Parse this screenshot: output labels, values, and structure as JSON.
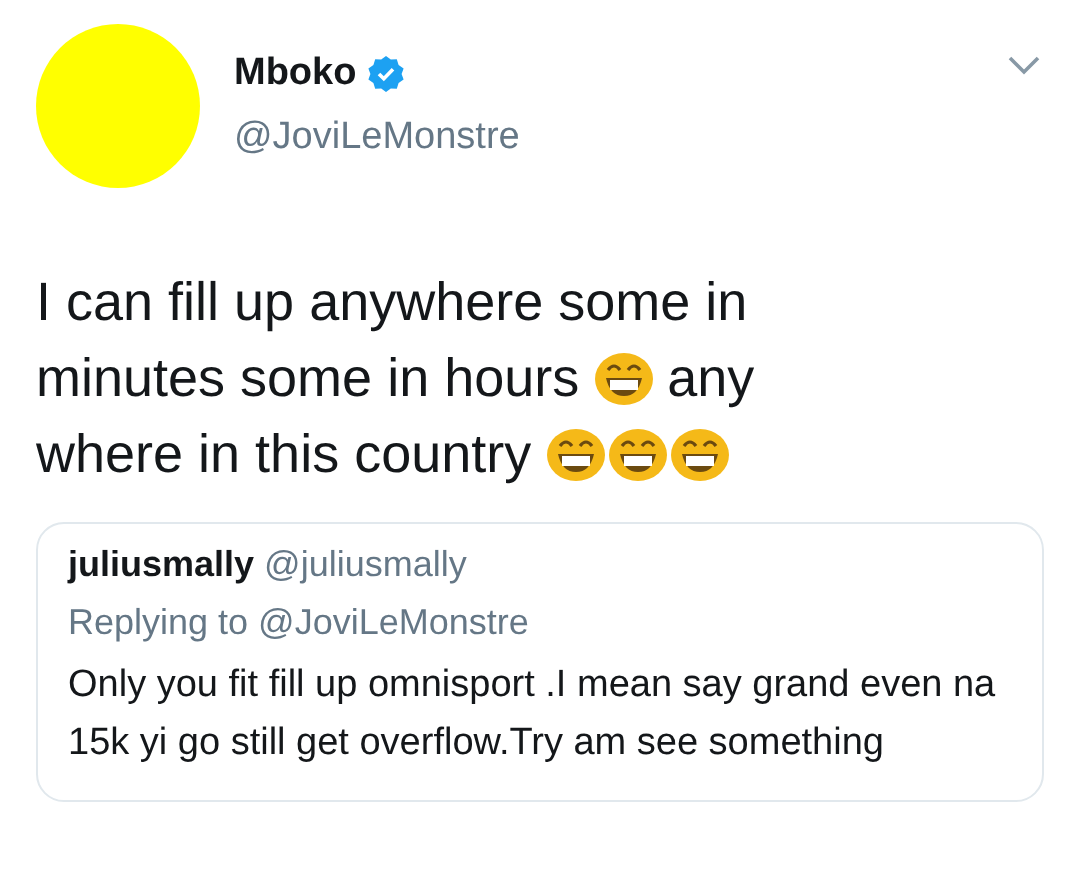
{
  "tweet": {
    "author": {
      "name": "Mboko",
      "verified": true,
      "handle": "@JoviLeMonstre"
    },
    "lines": [
      [
        {
          "kind": "text",
          "text": "I can fill up anywhere some in"
        }
      ],
      [
        {
          "kind": "text",
          "text": "minutes some in hours"
        },
        {
          "kind": "emoji"
        },
        {
          "kind": "text",
          "text": "any"
        }
      ],
      [
        {
          "kind": "text",
          "text": "where in this country"
        },
        {
          "kind": "emoji"
        },
        {
          "kind": "emoji"
        },
        {
          "kind": "emoji"
        }
      ]
    ],
    "quoted": {
      "name": "juliusmally",
      "handle": "@juliusmally",
      "replying_to": "Replying to @JoviLeMonstre",
      "text": "Only you fit fill up omnisport .I mean say grand even na 15k yi go still get overflow.Try am see something"
    }
  }
}
